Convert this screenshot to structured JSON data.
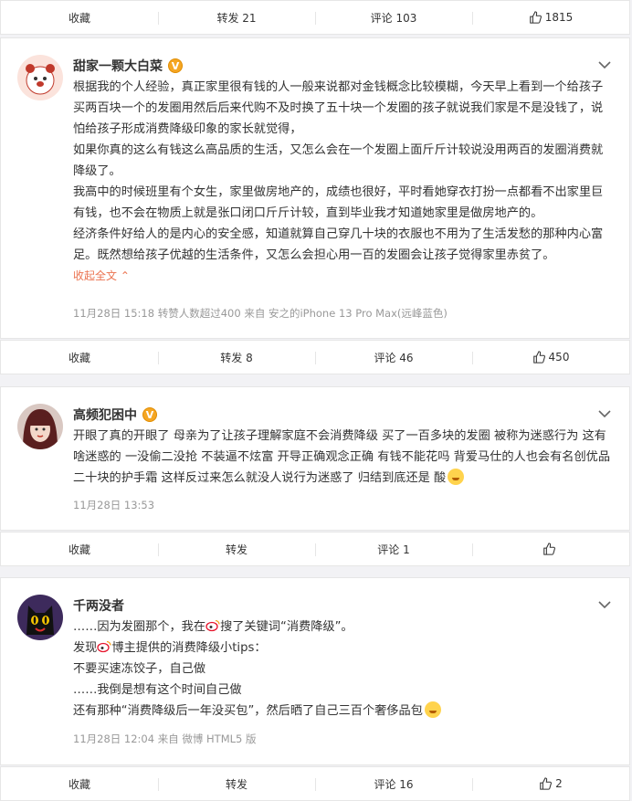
{
  "top_actions": {
    "collect": "收藏",
    "repost": "转发 21",
    "comment": "评论 103",
    "like": "1815"
  },
  "posts": [
    {
      "username": "甜家一颗大白菜",
      "verified": "V",
      "paragraphs": [
        "根据我的个人经验，真正家里很有钱的人一般来说都对金钱概念比较模糊，今天早上看到一个给孩子买两百块一个的发圈用然后后来代购不及时换了五十块一个发圈的孩子就说我们家是不是没钱了，说怕给孩子形成消费降级印象的家长就觉得，",
        "如果你真的这么有钱这么高品质的生活，又怎么会在一个发圈上面斤斤计较说没用两百的发圈消费就降级了。",
        "我高中的时候班里有个女生，家里做房地产的，成绩也很好，平时看她穿衣打扮一点都看不出家里巨有钱，也不会在物质上就是张口闭口斤斤计较，直到毕业我才知道她家里是做房地产的。",
        "经济条件好给人的是内心的安全感，知道就算自己穿几十块的衣服也不用为了生活发愁的那种内心富足。既然想给孩子优越的生活条件，又怎么会担心用一百的发圈会让孩子觉得家里赤贫了。"
      ],
      "collapse": "收起全文",
      "meta": "11月28日 15:18 转赞人数超过400  来自 安之的iPhone 13 Pro Max(远峰蓝色)",
      "actions": {
        "collect": "收藏",
        "repost": "转发 8",
        "comment": "评论 46",
        "like": "450"
      }
    },
    {
      "username": "高频犯困中",
      "verified": "V",
      "text1": "开眼了真的开眼了 母亲为了让孩子理解家庭不会消费降级 买了一百多块的发圈 被称为迷惑行为 这有啥迷惑的 一没偷二没抢 不装逼不炫富 开导正确观念正确 有钱不能花吗 背爱马仕的人也会有名创优品二十块的护手霜 这样反过来怎么就没人说行为迷惑了 归结到底还是 酸",
      "meta": "11月28日 13:53",
      "actions": {
        "collect": "收藏",
        "repost": "转发",
        "comment": "评论 1",
        "like": ""
      }
    },
    {
      "username": "千两没者",
      "lines": [
        "……因为发圈那个，我在",
        "搜了关键词“消费降级”。",
        "发现",
        "博主提供的消费降级小tips：",
        "不要买速冻饺子，自己做",
        "……我倒是想有这个时间自己做",
        "还有那种“消费降级后一年没买包”，然后晒了自己三百个奢侈品包"
      ],
      "meta": "11月28日 12:04  来自 微博 HTML5 版",
      "actions": {
        "collect": "收藏",
        "repost": "转发",
        "comment": "评论 16",
        "like": "2"
      }
    }
  ],
  "colors": {
    "accent": "#eb7350",
    "meta": "#999999",
    "badge": "#f5a623"
  }
}
